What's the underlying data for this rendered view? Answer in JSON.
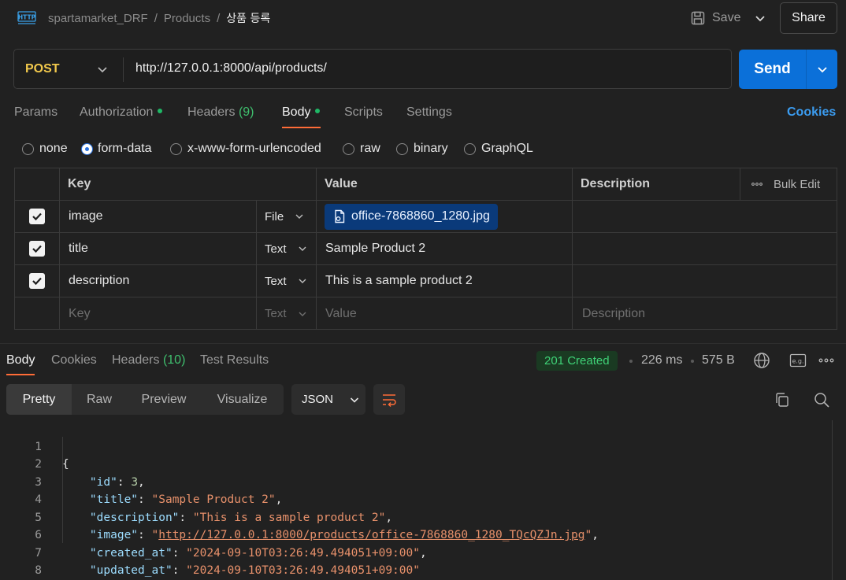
{
  "header": {
    "breadcrumb": [
      "spartamarket_DRF",
      "Products",
      "상품 등록"
    ],
    "save_label": "Save",
    "share_label": "Share"
  },
  "request": {
    "method": "POST",
    "url": "http://127.0.0.1:8000/api/products/",
    "send_label": "Send"
  },
  "req_tabs": {
    "params": "Params",
    "authorization": "Authorization",
    "headers": "Headers",
    "headers_count": "(9)",
    "body": "Body",
    "scripts": "Scripts",
    "settings": "Settings",
    "cookies": "Cookies"
  },
  "body_types": {
    "none": "none",
    "form_data": "form-data",
    "urlencoded": "x-www-form-urlencoded",
    "raw": "raw",
    "binary": "binary",
    "graphql": "GraphQL",
    "selected": "form-data"
  },
  "params_table": {
    "col_key": "Key",
    "col_value": "Value",
    "col_description": "Description",
    "bulk_edit": "Bulk Edit",
    "rows": [
      {
        "key": "image",
        "type": "File",
        "value": "office-7868860_1280.jpg",
        "checked": true
      },
      {
        "key": "title",
        "type": "Text",
        "value": "Sample Product 2",
        "checked": true
      },
      {
        "key": "description",
        "type": "Text",
        "value": "This is a sample product 2",
        "checked": true
      }
    ],
    "empty_row": {
      "key": "Key",
      "type": "Text",
      "value": "Value",
      "description": "Description"
    }
  },
  "response": {
    "tabs": {
      "body": "Body",
      "cookies": "Cookies",
      "headers": "Headers",
      "headers_count": "(10)",
      "test_results": "Test Results"
    },
    "status": "201 Created",
    "time": "226 ms",
    "size": "575 B",
    "view_tabs": {
      "pretty": "Pretty",
      "raw": "Raw",
      "preview": "Preview",
      "visualize": "Visualize"
    },
    "format": "JSON",
    "lines": [
      {
        "n": "1",
        "open": "{"
      },
      {
        "n": "2",
        "key": "\"id\"",
        "num": "3",
        "trail": ","
      },
      {
        "n": "3",
        "key": "\"title\"",
        "str": "\"Sample Product 2\"",
        "trail": ","
      },
      {
        "n": "4",
        "key": "\"description\"",
        "str": "\"This is a sample product 2\"",
        "trail": ","
      },
      {
        "n": "5",
        "key": "\"image\"",
        "url": "http://127.0.0.1:8000/products/office-7868860_1280_TQcQZJn.jpg",
        "trail": ","
      },
      {
        "n": "6",
        "key": "\"created_at\"",
        "str": "\"2024-09-10T03:26:49.494051+09:00\"",
        "trail": ","
      },
      {
        "n": "7",
        "key": "\"updated_at\"",
        "str": "\"2024-09-10T03:26:49.494051+09:00\"",
        "trail": ""
      },
      {
        "n": "8",
        "close": "}"
      }
    ]
  }
}
